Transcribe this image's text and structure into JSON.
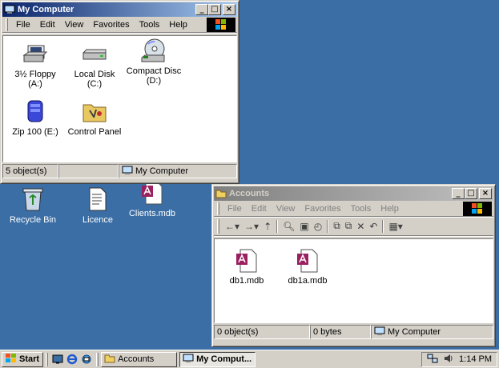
{
  "colors": {
    "desktop": "#3a6ea5",
    "title_active": "#0a246a",
    "title_inactive": "#808080"
  },
  "desktop_icons": [
    {
      "label": "Recycle Bin",
      "icon": "recycle-bin-icon"
    },
    {
      "label": "Licence",
      "icon": "document-icon"
    },
    {
      "label": "Clients.mdb",
      "icon": "access-db-icon"
    }
  ],
  "my_computer": {
    "title": "My Computer",
    "menu": [
      {
        "label": "File"
      },
      {
        "label": "Edit"
      },
      {
        "label": "View"
      },
      {
        "label": "Favorites"
      },
      {
        "label": "Tools"
      },
      {
        "label": "Help"
      }
    ],
    "items": [
      {
        "label": "3½ Floppy (A:)",
        "icon": "floppy-drive-icon"
      },
      {
        "label": "Local Disk (C:)",
        "icon": "hard-disk-icon"
      },
      {
        "label": "Compact Disc (D:)",
        "icon": "cd-drive-icon"
      },
      {
        "label": "Zip 100 (E:)",
        "icon": "zip-drive-icon"
      },
      {
        "label": "Control Panel",
        "icon": "control-panel-icon"
      }
    ],
    "status": {
      "count": "5 object(s)",
      "location": "My Computer"
    }
  },
  "accounts": {
    "title": "Accounts",
    "menu": [
      {
        "label": "File"
      },
      {
        "label": "Edit"
      },
      {
        "label": "View"
      },
      {
        "label": "Favorites"
      },
      {
        "label": "Tools"
      },
      {
        "label": "Help"
      }
    ],
    "files": [
      {
        "label": "db1.mdb",
        "icon": "access-db-icon"
      },
      {
        "label": "db1a.mdb",
        "icon": "access-db-icon"
      }
    ],
    "status": {
      "count": "0 object(s)",
      "size": "0 bytes",
      "location": "My Computer"
    }
  },
  "taskbar": {
    "start_label": "Start",
    "buttons": [
      {
        "label": "Accounts",
        "active": false
      },
      {
        "label": "My Comput...",
        "active": true
      }
    ],
    "clock": "1:14 PM"
  }
}
